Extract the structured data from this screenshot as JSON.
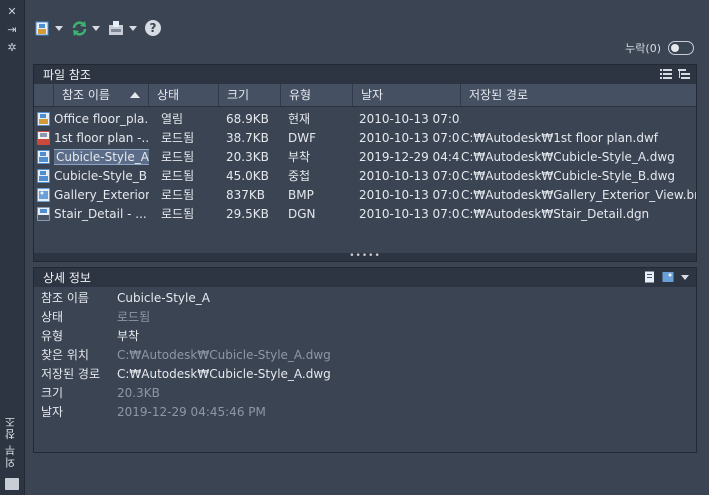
{
  "sidebar": {
    "vertical_label": "외부 참조",
    "icons": [
      "close-icon",
      "pin-icon",
      "settings-icon"
    ]
  },
  "toolbar": {
    "buttons": [
      "attach-icon",
      "refresh-icon",
      "change-path-icon"
    ],
    "help_label": "?"
  },
  "toggle": {
    "label": "누락(0)"
  },
  "refs": {
    "title": "파일 참조",
    "columns": [
      "참조 이름",
      "상태",
      "크기",
      "유형",
      "날자",
      "저장된 경로"
    ],
    "rows": [
      {
        "name": "Office floor_pla...",
        "status": "열림",
        "size": "68.9KB",
        "type": "현재",
        "date": "2010-10-13 07:0...",
        "path": "",
        "icon": "dwg-icon",
        "color": "#d49a3a"
      },
      {
        "name": "1st floor plan -...",
        "status": "로드됨",
        "size": "38.7KB",
        "type": "DWF",
        "date": "2010-10-13 07:0...",
        "path": "C:₩Autodesk₩1st floor plan.dwf",
        "icon": "dwf-icon",
        "color": "#c94a3a"
      },
      {
        "name": "Cubicle-Style_A",
        "status": "로드됨",
        "size": "20.3KB",
        "type": "부착",
        "date": "2019-12-29 04:4...",
        "path": "C:₩Autodesk₩Cubicle-Style_A.dwg",
        "icon": "dwg-icon",
        "color": "#4f8fd0"
      },
      {
        "name": "Cubicle-Style_B",
        "status": "로드됨",
        "size": "45.0KB",
        "type": "중첩",
        "date": "2010-10-13 07:0...",
        "path": "C:₩Autodesk₩Cubicle-Style_B.dwg",
        "icon": "dwg-icon",
        "color": "#4f8fd0"
      },
      {
        "name": "Gallery_Exterior...",
        "status": "로드됨",
        "size": "837KB",
        "type": "BMP",
        "date": "2010-10-13 07:0...",
        "path": "C:₩Autodesk₩Gallery_Exterior_View.bmp",
        "icon": "image-icon",
        "color": "#6aa0d8"
      },
      {
        "name": "Stair_Detail - ...",
        "status": "로드됨",
        "size": "29.5KB",
        "type": "DGN",
        "date": "2010-10-13 07:0...",
        "path": "C:₩Autodesk₩Stair_Detail.dgn",
        "icon": "dgn-icon",
        "color": "#8a9bb0"
      }
    ],
    "grip": "•••••"
  },
  "details": {
    "title": "상세 정보",
    "rows": [
      {
        "label": "참조 이름",
        "value": "Cubicle-Style_A",
        "dim": false
      },
      {
        "label": "상태",
        "value": "로드됨",
        "dim": true
      },
      {
        "label": "유형",
        "value": "부착",
        "dim": false
      },
      {
        "label": "찾은 위치",
        "value": "C:₩Autodesk₩Cubicle-Style_A.dwg",
        "dim": true
      },
      {
        "label": "저장된 경로",
        "value": "C:₩Autodesk₩Cubicle-Style_A.dwg",
        "dim": false
      },
      {
        "label": "크기",
        "value": "20.3KB",
        "dim": true
      },
      {
        "label": "날자",
        "value": "2019-12-29 04:45:46 PM",
        "dim": true
      }
    ]
  },
  "colors": {
    "background": "#3b4453",
    "header": "#2e3542",
    "selection": "#5a6c87"
  }
}
